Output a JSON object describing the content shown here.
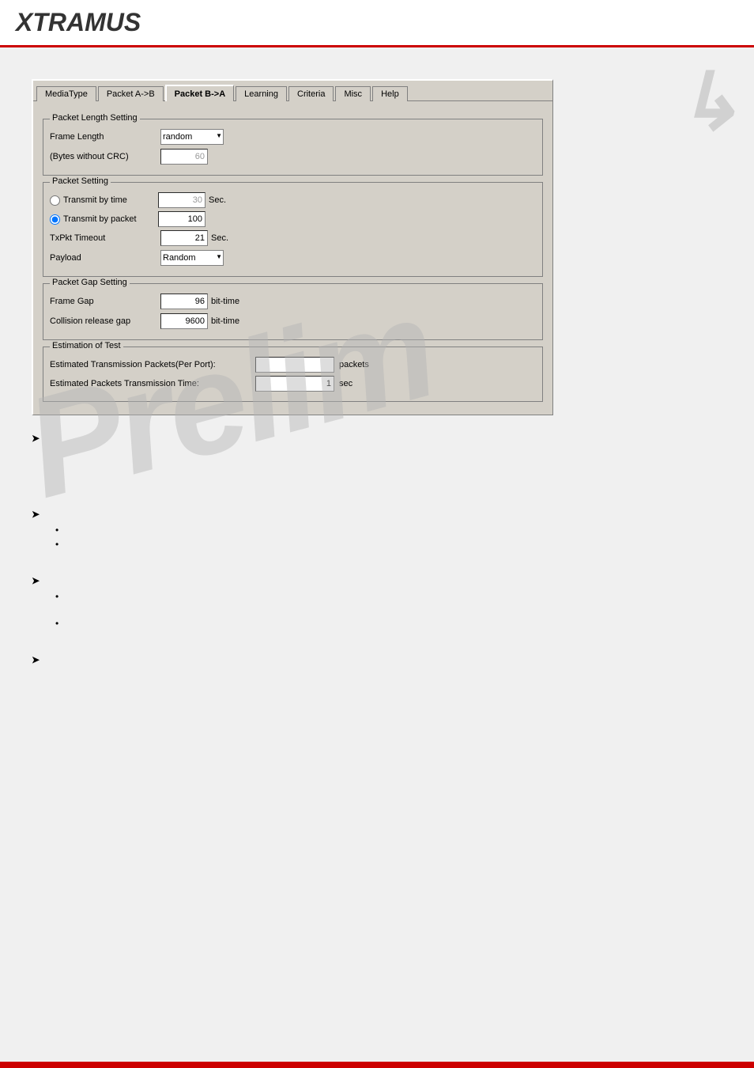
{
  "header": {
    "logo_x": "X",
    "logo_rest": "TRAMUS"
  },
  "tabs": [
    {
      "label": "MediaType",
      "active": false
    },
    {
      "label": "Packet A->B",
      "active": false
    },
    {
      "label": "Packet B->A",
      "active": true
    },
    {
      "label": "Learning",
      "active": false
    },
    {
      "label": "Criteria",
      "active": false
    },
    {
      "label": "Misc",
      "active": false
    },
    {
      "label": "Help",
      "active": false
    }
  ],
  "packet_length_setting": {
    "title": "Packet Length Setting",
    "frame_length_label": "Frame Length",
    "frame_length_value": "random",
    "bytes_label": "(Bytes without CRC)",
    "bytes_value": "60"
  },
  "packet_setting": {
    "title": "Packet Setting",
    "transmit_by_time_label": "Transmit by time",
    "transmit_by_time_value": "30",
    "transmit_by_time_unit": "Sec.",
    "transmit_by_packet_label": "Transmit by packet",
    "transmit_by_packet_value": "100",
    "txpkt_timeout_label": "TxPkt Timeout",
    "txpkt_timeout_value": "21",
    "txpkt_timeout_unit": "Sec.",
    "payload_label": "Payload",
    "payload_value": "Random"
  },
  "packet_gap_setting": {
    "title": "Packet Gap Setting",
    "frame_gap_label": "Frame Gap",
    "frame_gap_value": "96",
    "frame_gap_unit": "bit-time",
    "collision_release_gap_label": "Collision release gap",
    "collision_release_gap_value": "9600",
    "collision_release_gap_unit": "bit-time"
  },
  "estimation_of_test": {
    "title": "Estimation of Test",
    "estimated_tx_packets_label": "Estimated Transmission Packets(Per Port):",
    "estimated_tx_packets_value": "",
    "estimated_tx_packets_unit": "packets",
    "estimated_tx_time_label": "Estimated Packets Transmission Time:",
    "estimated_tx_time_value": "1",
    "estimated_tx_time_unit": "sec"
  },
  "watermark": "Prelim",
  "body_sections": [
    {
      "type": "arrow",
      "text": ""
    },
    {
      "type": "arrow",
      "text": "",
      "bullets": [
        "",
        ""
      ]
    },
    {
      "type": "arrow",
      "text": "",
      "bullets": [
        "",
        ""
      ]
    },
    {
      "type": "arrow",
      "text": ""
    }
  ]
}
